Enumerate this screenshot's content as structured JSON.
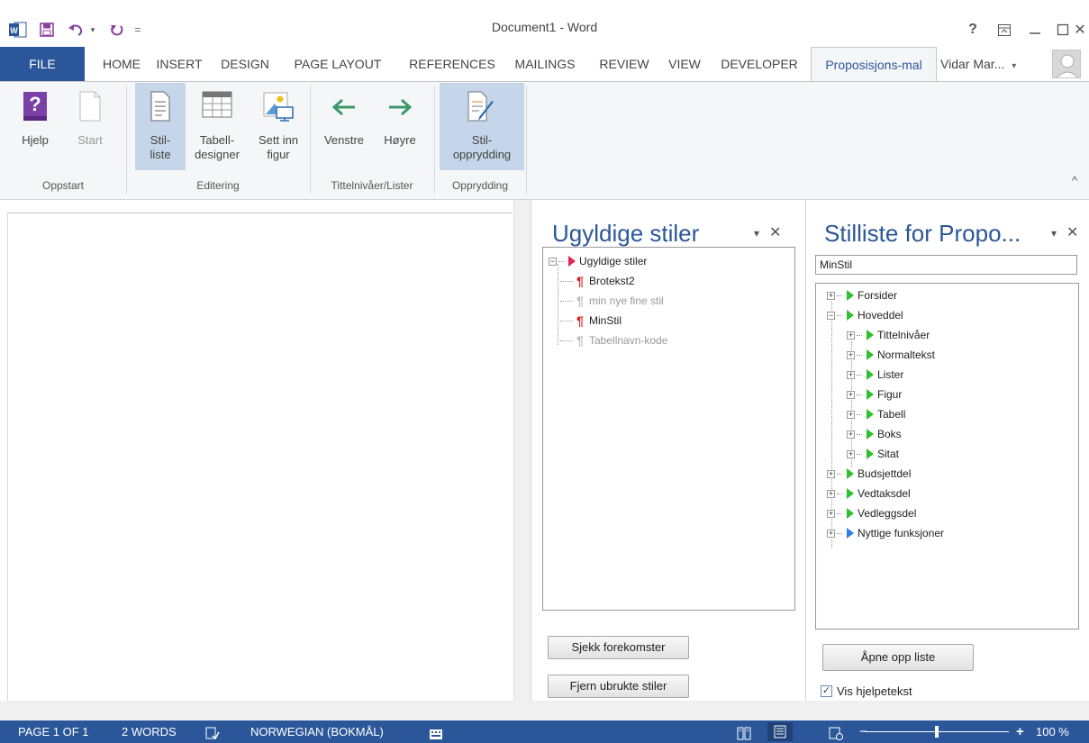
{
  "window": {
    "title": "Document1 - Word",
    "controls": {
      "help": "?",
      "restore_ribbon": "⊼",
      "minimize": "—",
      "maximize": "☐",
      "close": "✕"
    }
  },
  "qat": {
    "word_icon": "word-app-icon",
    "save_icon": "save-icon",
    "undo_icon": "undo-icon",
    "redo_icon": "redo-icon",
    "customize_icon": "="
  },
  "tabs": [
    {
      "label": "FILE"
    },
    {
      "label": "HOME"
    },
    {
      "label": "INSERT"
    },
    {
      "label": "DESIGN"
    },
    {
      "label": "PAGE LAYOUT"
    },
    {
      "label": "REFERENCES"
    },
    {
      "label": "MAILINGS"
    },
    {
      "label": "REVIEW"
    },
    {
      "label": "VIEW"
    },
    {
      "label": "DEVELOPER"
    },
    {
      "label": "Proposisjons-mal"
    }
  ],
  "user": {
    "name": "Vidar Mar...",
    "dropdown": "▾"
  },
  "ribbon": {
    "groups": [
      {
        "label": "Oppstart"
      },
      {
        "label": "Editering"
      },
      {
        "label": "Tittelnivåer/Lister"
      },
      {
        "label": "Opprydding"
      }
    ],
    "buttons": [
      {
        "label": "Hjelp"
      },
      {
        "label": "Start"
      },
      {
        "label": "Stil-\nliste"
      },
      {
        "label": "Tabell-\ndesigner"
      },
      {
        "label": "Sett inn\nfigur"
      },
      {
        "label": "Venstre"
      },
      {
        "label": "Høyre"
      },
      {
        "label": "Stil-\nopprydding"
      }
    ],
    "collapse": "^"
  },
  "pane_invalid": {
    "title": "Ugyldige stiler",
    "menu": "▾",
    "close": "✕",
    "root": "Ugyldige stiler",
    "items": [
      "Brotekst2",
      "min nye fine stil",
      "MinStil",
      "Tabellnavn-kode"
    ],
    "buttons": {
      "check": "Sjekk forekomster",
      "remove": "Fjern ubrukte stiler"
    }
  },
  "pane_stylelist": {
    "title": "Stilliste for Propo...",
    "menu": "▾",
    "close": "✕",
    "search_value": "MinStil",
    "items": [
      "Forsider",
      "Hoveddel",
      "Tittelnivåer",
      "Normaltekst",
      "Lister",
      "Figur",
      "Tabell",
      "Boks",
      "Sitat",
      "Budsjettdel",
      "Vedtaksdel",
      "Vedleggsdel",
      "Nyttige funksjoner"
    ],
    "open_button": "Åpne opp liste",
    "checkbox_label": "Vis hjelpetekst",
    "checkbox_mark": "✓"
  },
  "status": {
    "page": "PAGE 1 OF 1",
    "words": "2 WORDS",
    "language": "NORWEGIAN (BOKMÅL)",
    "zoom_minus": "−",
    "zoom_plus": "+",
    "zoom": "100 %",
    "zoom_level": 0.5
  },
  "colors": {
    "accent": "#2b579a",
    "green_arrow": "#2fbf2f",
    "red_arrow": "#e0244a",
    "blue_arrow": "#2f7fe0",
    "pilcrow_red": "#d91c1c"
  }
}
